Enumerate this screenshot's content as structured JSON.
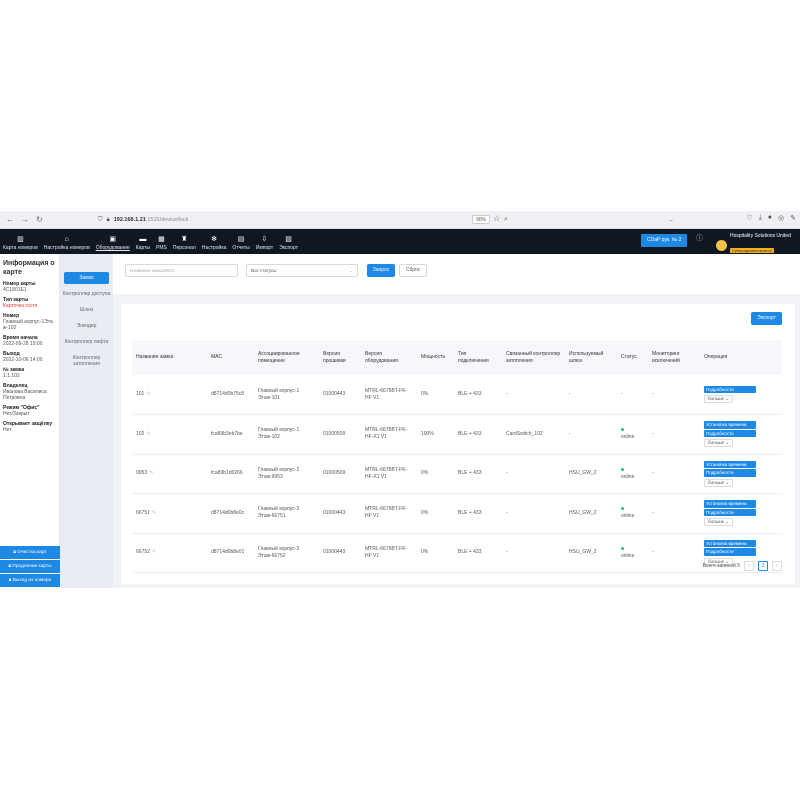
{
  "browser": {
    "url_host": "192.168.1.21",
    "url_path": ":1515/device/lock",
    "zoom": "90%"
  },
  "nav": {
    "items": [
      {
        "label": "Карта номеров",
        "icon": "building-icon"
      },
      {
        "label": "Настройка номеров",
        "icon": "home-icon"
      },
      {
        "label": "Оборудование",
        "icon": "lock-icon"
      },
      {
        "label": "Карты",
        "icon": "card-icon"
      },
      {
        "label": "PMS",
        "icon": "pms-icon"
      },
      {
        "label": "Персонал",
        "icon": "person-icon"
      },
      {
        "label": "Настройка",
        "icon": "gear-icon"
      },
      {
        "label": "Отчеты",
        "icon": "calendar-icon"
      },
      {
        "label": "Импорт",
        "icon": "import-icon"
      },
      {
        "label": "Экспорт",
        "icon": "export-icon"
      }
    ],
    "hotel_button": "CDaP рук. № 2",
    "company": "Hospitality Solutions United",
    "role": "Суперадминистратор"
  },
  "info": {
    "title": "Информация о карте",
    "fields": [
      {
        "label": "Номер карты",
        "value": "4C1801E1",
        "red": false
      },
      {
        "label": "Тип карты",
        "value": "Карточка гостя",
        "red": true
      },
      {
        "label": "Номер",
        "value": "Главный корпус-1Эта ж-102",
        "red": false
      },
      {
        "label": "Время начала",
        "value": "2022-09-28 19:00",
        "red": false
      },
      {
        "label": "Выход",
        "value": "2022-10-06 14:00",
        "red": false
      },
      {
        "label": "№ замка",
        "value": "1.1.102",
        "red": false
      },
      {
        "label": "Владелец",
        "value": "Иванова Василиса Петровна",
        "red": false
      },
      {
        "label": "Режим \"Офис\"",
        "value": "Нет/Закрыт",
        "red": false
      },
      {
        "label": "Открывает защёлку",
        "value": "Нет",
        "red": false
      }
    ],
    "actions": [
      "Очистка карт",
      "Продление карты",
      "Выход из номера"
    ]
  },
  "submenu": [
    "Замок",
    "Контроллер доступа",
    "Шлюз",
    "Энкодер",
    "Контроллер лифта",
    "Контроллер затопления"
  ],
  "filters": {
    "search_placeholder": "Название замка/MAC",
    "status": "Все статусы",
    "query": "Запрос",
    "reset": "Сброс"
  },
  "export_label": "Экспорт",
  "table": {
    "headers": [
      "Название замка",
      "MAC",
      "Ассоциированное помещение",
      "Версия прошивки",
      "Версия оборудования",
      "Мощность",
      "Тип подключения",
      "Связанный контроллер затопления",
      "Используемый шлюз",
      "Статус",
      "Мониторинг исключений",
      "Операция"
    ],
    "rows": [
      {
        "name": "101",
        "mac": "d8714d0b75c8",
        "room": "Главный корпус-1 Этаж-101",
        "fw": "01000443",
        "hw": "MTRL-6675BT-FK-HF V1",
        "power": "0%",
        "conn": "BLE + 433",
        "flood": "-",
        "gateway": "-",
        "status": "-",
        "online": false,
        "monitor": "-",
        "ops": [
          "Подробности"
        ]
      },
      {
        "name": "102",
        "mac": "fca89b3eb7be",
        "room": "Главный корпус-1 Этаж-102",
        "fw": "01000509",
        "hw": "MTRL-6675BT-FK-HF-X1 V1",
        "power": "100%",
        "conn": "BLE + 433",
        "flood": "CardSwitch_102",
        "gateway": "-",
        "status": "online",
        "online": true,
        "monitor": "-",
        "ops": [
          "Установка времени",
          "Подробности"
        ]
      },
      {
        "name": "9953",
        "mac": "fca89b1d0266",
        "room": "Главный корпус-2 Этаж-9953",
        "fw": "01000509",
        "hw": "MTRL-6675BT-FK-HF-X1 V1",
        "power": "0%",
        "conn": "BLE + 433",
        "flood": "-",
        "gateway": "HSU_GW_2",
        "status": "online",
        "online": true,
        "monitor": "-",
        "ops": [
          "Установка времени",
          "Подробности"
        ]
      },
      {
        "name": "66751",
        "mac": "d8714d0b8e0c",
        "room": "Главный корпус-3 Этаж-66751",
        "fw": "01000443",
        "hw": "MTRL-6675BT-FK-HF V1",
        "power": "0%",
        "conn": "BLE + 433",
        "flood": "-",
        "gateway": "HSU_GW_2",
        "status": "online",
        "online": true,
        "monitor": "-",
        "ops": [
          "Установка времени",
          "Подробности"
        ]
      },
      {
        "name": "66752",
        "mac": "d8714d0b8e01",
        "room": "Главный корпус-3 Этаж-66752",
        "fw": "01000443",
        "hw": "MTRL-6675BT-FK-HF V1",
        "power": "0%",
        "conn": "BLE + 433",
        "flood": "-",
        "gateway": "HSU_GW_2",
        "status": "online",
        "online": true,
        "monitor": "-",
        "ops": [
          "Установка времени",
          "Подробности"
        ]
      }
    ],
    "more_label": "больше"
  },
  "pager": {
    "total": "Всего записей 5",
    "current": "1"
  }
}
